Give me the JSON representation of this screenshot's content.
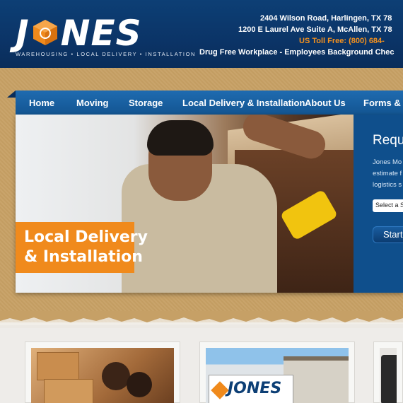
{
  "header": {
    "logo_text_left": "J",
    "logo_text_right": "NES",
    "tagline": "WAREHOUSING • LOCAL DELIVERY • INSTALLATION",
    "address_1": "2404 Wilson Road, Harlingen, TX 78",
    "address_2": "1200 E Laurel Ave Suite A, McAllen, TX 78",
    "phone": "US Toll Free: (800) 684-",
    "notice": "Drug Free Workplace - Employees Background Chec"
  },
  "nav": {
    "items": [
      "Home",
      "Moving",
      "Storage",
      "Local Delivery & Installation",
      "About Us",
      "Forms & Re"
    ]
  },
  "hero": {
    "label_line1": "Local Delivery",
    "label_line2": "& Installation"
  },
  "quote": {
    "title": "Reque",
    "text_1": "Jones Mo",
    "text_2": "estimate f",
    "text_3": "logistics s",
    "select_value": "Select a S",
    "button_label": "Start"
  },
  "cards": {
    "truck_logo": "JONES"
  },
  "colors": {
    "header_blue": "#0b3467",
    "nav_blue": "#1a62a6",
    "accent_orange": "#f08a1c",
    "phone_orange": "#f6921e"
  }
}
